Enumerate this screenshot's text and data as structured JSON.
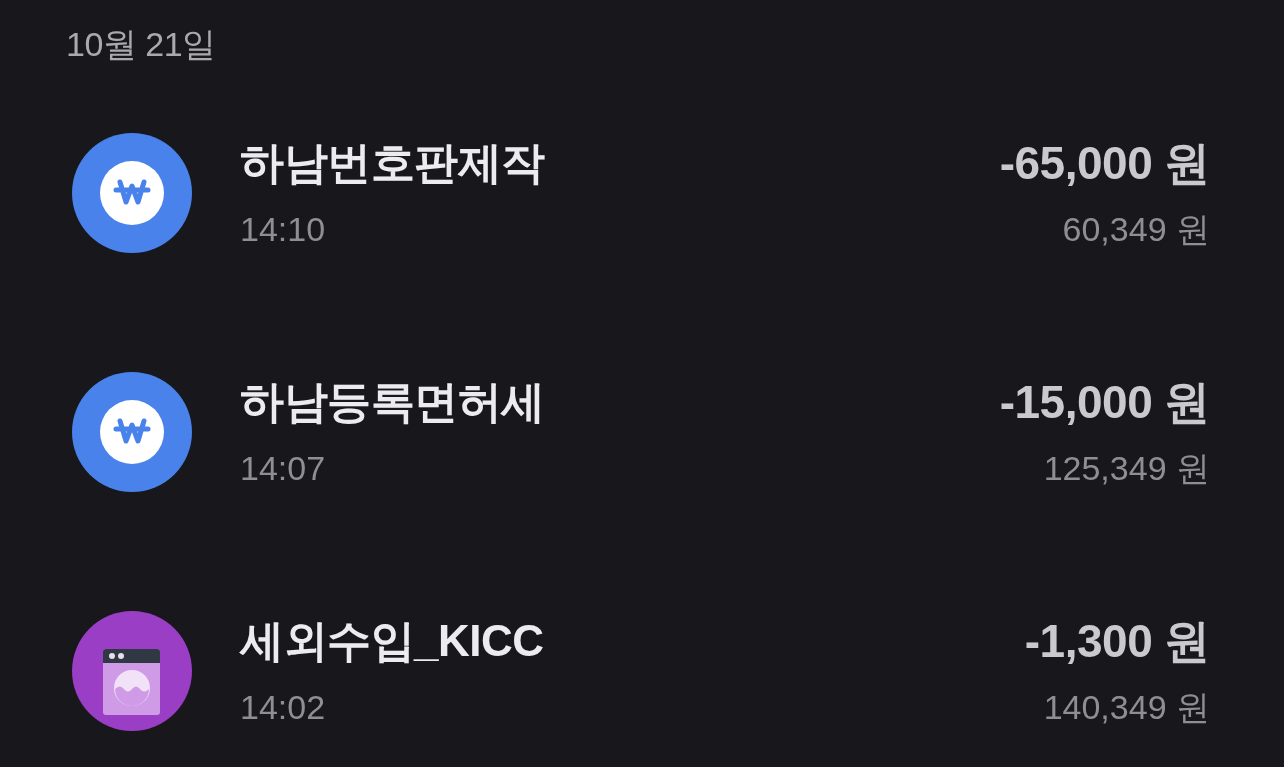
{
  "date_header": "10월 21일",
  "transactions": [
    {
      "icon": {
        "kind": "won",
        "color": "#4a82ec"
      },
      "title": "하남번호판제작",
      "time": "14:10",
      "amount": "-65,000 원",
      "balance": "60,349 원"
    },
    {
      "icon": {
        "kind": "won",
        "color": "#4a82ec"
      },
      "title": "하남등록면허세",
      "time": "14:07",
      "amount": "-15,000 원",
      "balance": "125,349 원"
    },
    {
      "icon": {
        "kind": "washer",
        "color": "#9a3ec6"
      },
      "title": "세외수입_KICC",
      "time": "14:02",
      "amount": "-1,300 원",
      "balance": "140,349 원"
    }
  ]
}
